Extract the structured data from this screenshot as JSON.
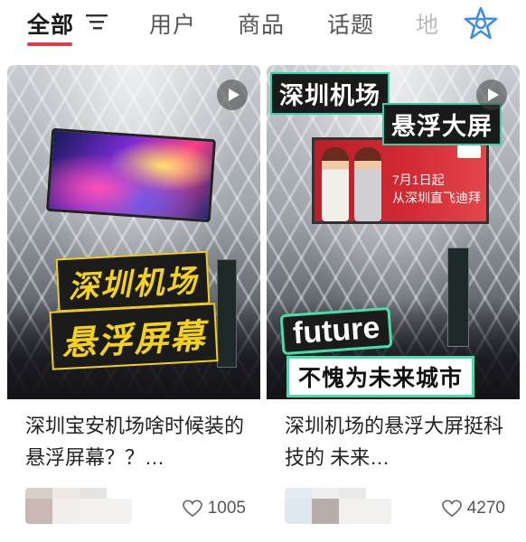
{
  "tabs": [
    {
      "label": "全部",
      "active": true
    },
    {
      "label": "用户",
      "active": false
    },
    {
      "label": "商品",
      "active": false
    },
    {
      "label": "话题",
      "active": false
    },
    {
      "label": "地",
      "active": false
    }
  ],
  "icons": {
    "filter": "filter-icon",
    "logo": "star-logo-icon",
    "play": "play-icon",
    "like": "heart-icon"
  },
  "colors": {
    "accent": "#e8364b",
    "logo_blue": "#3b8de8",
    "title_yellow": "#f4d21a",
    "title_teal_border": "#2fd3a6"
  },
  "cards": [
    {
      "thumbnail_text_line1": "深圳机场",
      "thumbnail_text_line2": "悬浮屏幕",
      "caption": "深圳宝安机场啥时候装的悬浮屏幕？？…",
      "likes": "1005"
    },
    {
      "thumbnail_text_line1": "深圳机场",
      "thumbnail_text_line2": "悬浮大屏",
      "ad_line1": "7月1日起",
      "ad_line2": "从深圳直飞迪拜",
      "overlay_word": "future",
      "overlay_sub": "不愧为未来城市",
      "caption": "深圳机场的悬浮大屏挺科技的 未来…",
      "likes": "4270"
    }
  ]
}
